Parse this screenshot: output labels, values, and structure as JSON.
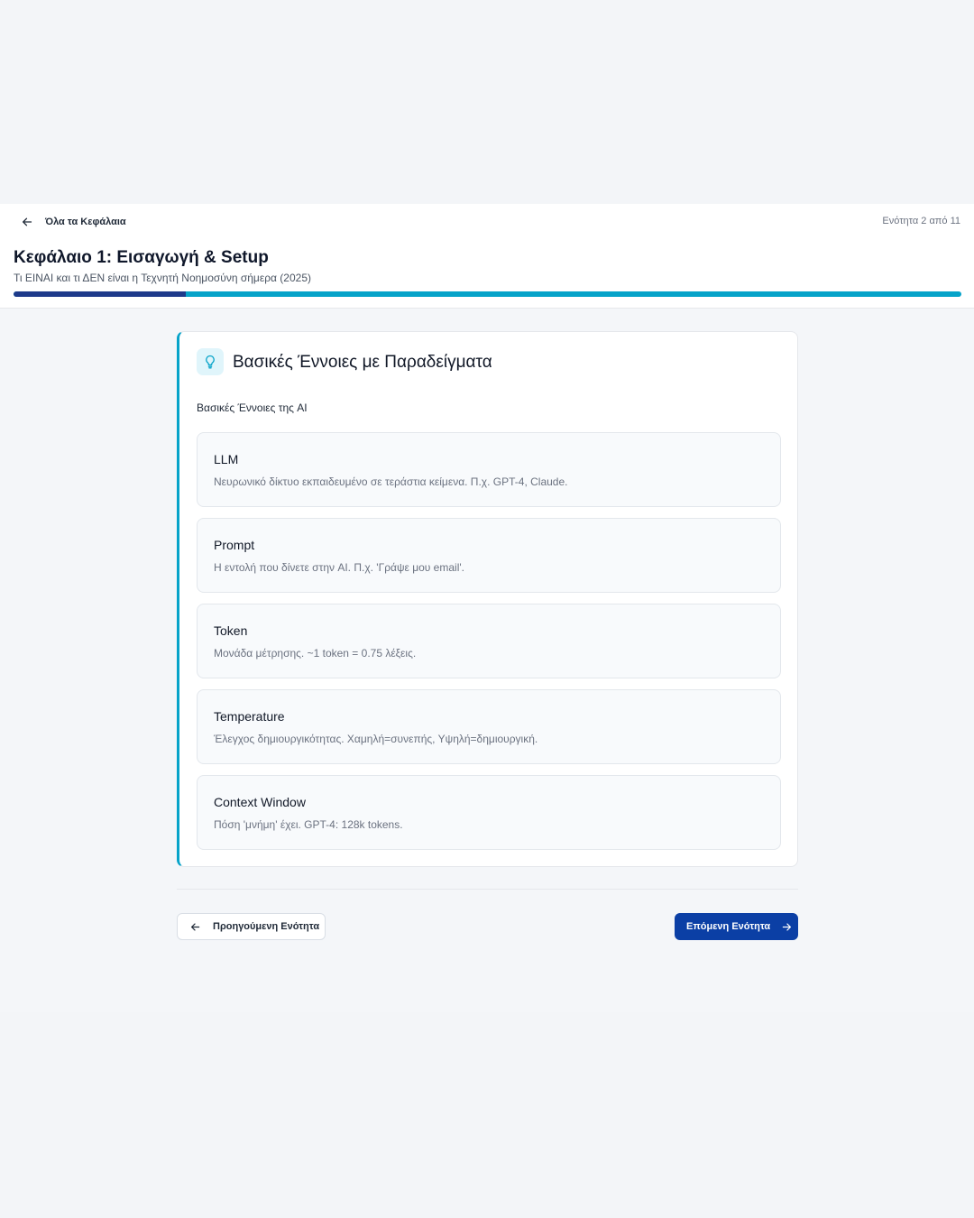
{
  "header": {
    "back_label": "Όλα τα Κεφάλαια",
    "section_counter": "Ενότητα 2 από 11",
    "chapter_title": "Κεφάλαιο 1: Εισαγωγή & Setup",
    "chapter_subtitle": "Τι ΕΙΝΑΙ και τι ΔΕΝ είναι η Τεχνητή Νοημοσύνη σήμερα (2025)",
    "progress_fraction": 0.182
  },
  "card": {
    "icon": "lightbulb-icon",
    "title": "Βασικές Έννοιες με Παραδείγματα",
    "intro": "Βασικές Έννοιες της AI",
    "concepts": [
      {
        "name": "LLM",
        "description": "Νευρωνικό δίκτυο εκπαιδευμένο σε τεράστια κείμενα. Π.χ. GPT-4, Claude."
      },
      {
        "name": "Prompt",
        "description": "Η εντολή που δίνετε στην AI. Π.χ. 'Γράψε μου email'."
      },
      {
        "name": "Token",
        "description": "Μονάδα μέτρησης. ~1 token = 0.75 λέξεις."
      },
      {
        "name": "Temperature",
        "description": "Έλεγχος δημιουργικότητας. Χαμηλή=συνεπής, Υψηλή=δημιουργική."
      },
      {
        "name": "Context Window",
        "description": "Πόση 'μνήμη' έχει. GPT-4: 128k tokens."
      }
    ]
  },
  "navigation": {
    "prev_label": "Προηγούμενη Ενότητα",
    "next_label": "Επόμενη Ενότητα"
  },
  "colors": {
    "accent": "#06a3c9",
    "progress_fill": "#1e3a8a",
    "primary_button": "#0b3fa5"
  }
}
